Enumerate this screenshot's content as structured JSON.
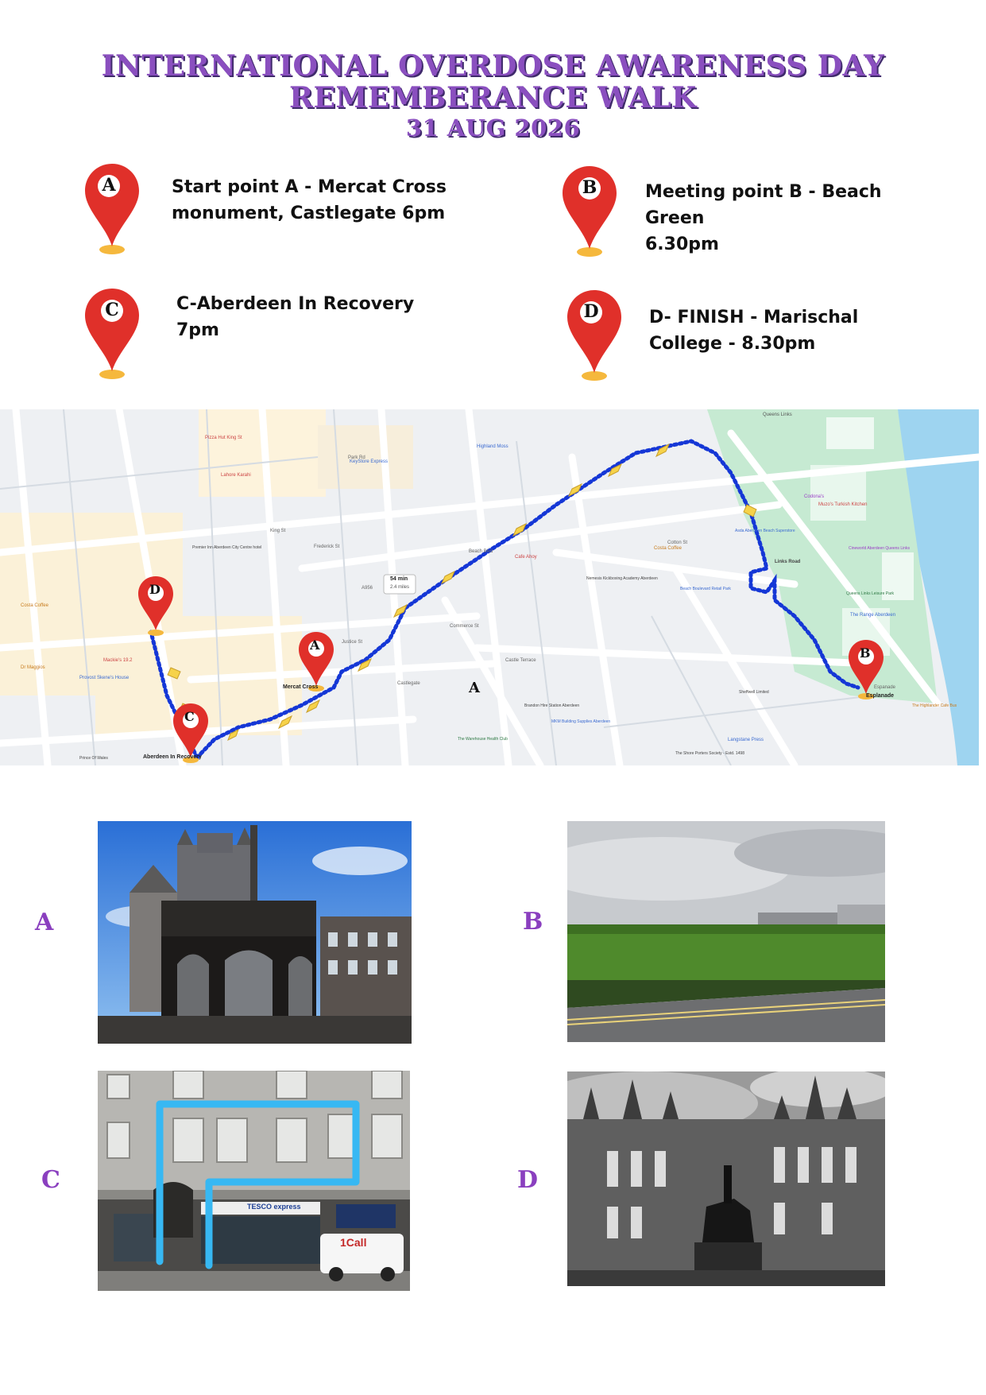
{
  "header": {
    "line1": "INTERNATIONAL OVERDOSE AWARENESS DAY",
    "line2": "REMEMBERANCE WALK",
    "date": "31 AUG 2026"
  },
  "points": [
    {
      "letter": "A",
      "lines": [
        "Start point A  - Mercat Cross",
        "monument, Castlegate 6pm"
      ]
    },
    {
      "letter": "B",
      "lines": [
        "Meeting point B - Beach",
        "Green",
        "6.30pm"
      ]
    },
    {
      "letter": "C",
      "lines": [
        "C-Aberdeen In Recovery",
        "7pm"
      ]
    },
    {
      "letter": "D",
      "lines": [
        "D- FINISH - Marischal",
        "College - 8.30pm"
      ]
    }
  ],
  "map": {
    "pins": [
      "A",
      "B",
      "C",
      "D"
    ],
    "route_label_a": "A",
    "aberdeen_in_recovery": "Aberdeen In Recovery",
    "mercat_cross": "Mercat Cross",
    "esplanade": "Esplanade",
    "walk_time": "54 min",
    "walk_distance": "2.4 miles",
    "streets": [
      "A956",
      "Park Rd",
      "Castle Terrace",
      "Castlegate",
      "Beach Blvd",
      "Links Road",
      "Justice St",
      "Commerce St",
      "Frederick St",
      "King St",
      "Espanade",
      "Cotton St"
    ],
    "places": [
      "Pizza Hut King St",
      "Lahore Karahi",
      "KeyStore Express",
      "Highland Moss",
      "Costa Coffee",
      "Asda Aberdeen Beach Superstore",
      "Beach Boulevard Retail Park",
      "Codona's",
      "Muzo's Turkish Kitchen",
      "The Range Aberdeen",
      "Queens Links Leisure Park",
      "Cineworld Aberdeen Queens Links",
      "Brandon Hire Station Aberdeen",
      "MKM Building Supplies Aberdeen",
      "Langstane Press",
      "The Highlander Cafe Bus",
      "Mackie's 19.2",
      "Provost Skene's House",
      "Costa Coffee",
      "Dr Maggios",
      "Nemesis Kickboxing Academy Aberdeen",
      "Cafe Ahoy",
      "Queens Links",
      "Premier Inn Aberdeen City Centre hotel",
      "The Warehouse Health Club",
      "Prince Of Wales",
      "Sheffwell Limited",
      "The Shore Porters Society - Estd. 1498"
    ]
  },
  "photos": [
    {
      "letter": "A"
    },
    {
      "letter": "B"
    },
    {
      "letter": "C",
      "shop_sign": "TESCO express",
      "van_sign": "1Call"
    },
    {
      "letter": "D"
    }
  ],
  "colors": {
    "title": "#8a4fbf",
    "title_shadow": "#3f2a6b",
    "pin_red": "#e0302a",
    "pin_base": "#f5b83d",
    "route_blue": "#1537d6",
    "chevron_yellow": "#f6d24a",
    "side_letter": "#8a3fbf"
  }
}
